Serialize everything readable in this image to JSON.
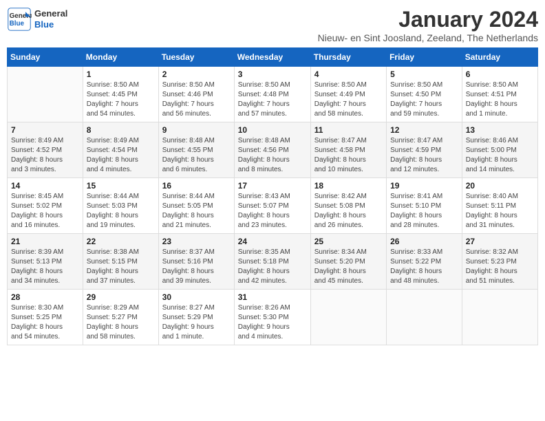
{
  "logo": {
    "line1": "General",
    "line2": "Blue"
  },
  "title": "January 2024",
  "subtitle": "Nieuw- en Sint Joosland, Zeeland, The Netherlands",
  "days_of_week": [
    "Sunday",
    "Monday",
    "Tuesday",
    "Wednesday",
    "Thursday",
    "Friday",
    "Saturday"
  ],
  "weeks": [
    [
      {
        "num": "",
        "info": ""
      },
      {
        "num": "1",
        "info": "Sunrise: 8:50 AM\nSunset: 4:45 PM\nDaylight: 7 hours\nand 54 minutes."
      },
      {
        "num": "2",
        "info": "Sunrise: 8:50 AM\nSunset: 4:46 PM\nDaylight: 7 hours\nand 56 minutes."
      },
      {
        "num": "3",
        "info": "Sunrise: 8:50 AM\nSunset: 4:48 PM\nDaylight: 7 hours\nand 57 minutes."
      },
      {
        "num": "4",
        "info": "Sunrise: 8:50 AM\nSunset: 4:49 PM\nDaylight: 7 hours\nand 58 minutes."
      },
      {
        "num": "5",
        "info": "Sunrise: 8:50 AM\nSunset: 4:50 PM\nDaylight: 7 hours\nand 59 minutes."
      },
      {
        "num": "6",
        "info": "Sunrise: 8:50 AM\nSunset: 4:51 PM\nDaylight: 8 hours\nand 1 minute."
      }
    ],
    [
      {
        "num": "7",
        "info": "Sunrise: 8:49 AM\nSunset: 4:52 PM\nDaylight: 8 hours\nand 3 minutes."
      },
      {
        "num": "8",
        "info": "Sunrise: 8:49 AM\nSunset: 4:54 PM\nDaylight: 8 hours\nand 4 minutes."
      },
      {
        "num": "9",
        "info": "Sunrise: 8:48 AM\nSunset: 4:55 PM\nDaylight: 8 hours\nand 6 minutes."
      },
      {
        "num": "10",
        "info": "Sunrise: 8:48 AM\nSunset: 4:56 PM\nDaylight: 8 hours\nand 8 minutes."
      },
      {
        "num": "11",
        "info": "Sunrise: 8:47 AM\nSunset: 4:58 PM\nDaylight: 8 hours\nand 10 minutes."
      },
      {
        "num": "12",
        "info": "Sunrise: 8:47 AM\nSunset: 4:59 PM\nDaylight: 8 hours\nand 12 minutes."
      },
      {
        "num": "13",
        "info": "Sunrise: 8:46 AM\nSunset: 5:00 PM\nDaylight: 8 hours\nand 14 minutes."
      }
    ],
    [
      {
        "num": "14",
        "info": "Sunrise: 8:45 AM\nSunset: 5:02 PM\nDaylight: 8 hours\nand 16 minutes."
      },
      {
        "num": "15",
        "info": "Sunrise: 8:44 AM\nSunset: 5:03 PM\nDaylight: 8 hours\nand 19 minutes."
      },
      {
        "num": "16",
        "info": "Sunrise: 8:44 AM\nSunset: 5:05 PM\nDaylight: 8 hours\nand 21 minutes."
      },
      {
        "num": "17",
        "info": "Sunrise: 8:43 AM\nSunset: 5:07 PM\nDaylight: 8 hours\nand 23 minutes."
      },
      {
        "num": "18",
        "info": "Sunrise: 8:42 AM\nSunset: 5:08 PM\nDaylight: 8 hours\nand 26 minutes."
      },
      {
        "num": "19",
        "info": "Sunrise: 8:41 AM\nSunset: 5:10 PM\nDaylight: 8 hours\nand 28 minutes."
      },
      {
        "num": "20",
        "info": "Sunrise: 8:40 AM\nSunset: 5:11 PM\nDaylight: 8 hours\nand 31 minutes."
      }
    ],
    [
      {
        "num": "21",
        "info": "Sunrise: 8:39 AM\nSunset: 5:13 PM\nDaylight: 8 hours\nand 34 minutes."
      },
      {
        "num": "22",
        "info": "Sunrise: 8:38 AM\nSunset: 5:15 PM\nDaylight: 8 hours\nand 37 minutes."
      },
      {
        "num": "23",
        "info": "Sunrise: 8:37 AM\nSunset: 5:16 PM\nDaylight: 8 hours\nand 39 minutes."
      },
      {
        "num": "24",
        "info": "Sunrise: 8:35 AM\nSunset: 5:18 PM\nDaylight: 8 hours\nand 42 minutes."
      },
      {
        "num": "25",
        "info": "Sunrise: 8:34 AM\nSunset: 5:20 PM\nDaylight: 8 hours\nand 45 minutes."
      },
      {
        "num": "26",
        "info": "Sunrise: 8:33 AM\nSunset: 5:22 PM\nDaylight: 8 hours\nand 48 minutes."
      },
      {
        "num": "27",
        "info": "Sunrise: 8:32 AM\nSunset: 5:23 PM\nDaylight: 8 hours\nand 51 minutes."
      }
    ],
    [
      {
        "num": "28",
        "info": "Sunrise: 8:30 AM\nSunset: 5:25 PM\nDaylight: 8 hours\nand 54 minutes."
      },
      {
        "num": "29",
        "info": "Sunrise: 8:29 AM\nSunset: 5:27 PM\nDaylight: 8 hours\nand 58 minutes."
      },
      {
        "num": "30",
        "info": "Sunrise: 8:27 AM\nSunset: 5:29 PM\nDaylight: 9 hours\nand 1 minute."
      },
      {
        "num": "31",
        "info": "Sunrise: 8:26 AM\nSunset: 5:30 PM\nDaylight: 9 hours\nand 4 minutes."
      },
      {
        "num": "",
        "info": ""
      },
      {
        "num": "",
        "info": ""
      },
      {
        "num": "",
        "info": ""
      }
    ]
  ]
}
